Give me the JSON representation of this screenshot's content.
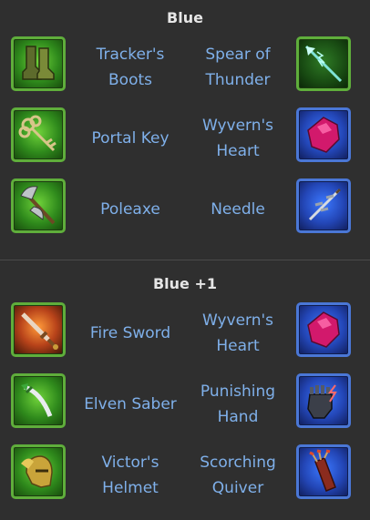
{
  "sections": [
    {
      "title": "Blue",
      "rows": [
        {
          "left": {
            "icon": "boots-icon",
            "color": "green",
            "lines": [
              "Tracker's",
              "Boots"
            ]
          },
          "right": {
            "icon": "spear-icon",
            "color": "green",
            "lines": [
              "Spear of",
              "Thunder"
            ]
          }
        },
        {
          "left": {
            "icon": "key-icon",
            "color": "green",
            "lines": [
              "Portal Key"
            ]
          },
          "right": {
            "icon": "heart-gem-icon",
            "color": "blue",
            "lines": [
              "Wyvern's",
              "Heart"
            ]
          }
        },
        {
          "left": {
            "icon": "poleaxe-icon",
            "color": "green",
            "lines": [
              "Poleaxe"
            ]
          },
          "right": {
            "icon": "needle-icon",
            "color": "blue",
            "lines": [
              "Needle"
            ]
          }
        }
      ]
    },
    {
      "title": "Blue +1",
      "rows": [
        {
          "left": {
            "icon": "fire-sword-icon",
            "color": "green",
            "lines": [
              "Fire Sword"
            ]
          },
          "right": {
            "icon": "heart-gem-icon",
            "color": "blue",
            "lines": [
              "Wyvern's",
              "Heart"
            ]
          }
        },
        {
          "left": {
            "icon": "saber-icon",
            "color": "green",
            "lines": [
              "Elven Saber"
            ]
          },
          "right": {
            "icon": "gauntlet-icon",
            "color": "blue",
            "lines": [
              "Punishing",
              "Hand"
            ]
          }
        },
        {
          "left": {
            "icon": "helmet-icon",
            "color": "green",
            "lines": [
              "Victor's",
              "Helmet"
            ]
          },
          "right": {
            "icon": "quiver-icon",
            "color": "blue",
            "lines": [
              "Scorching",
              "Quiver"
            ]
          }
        }
      ]
    }
  ]
}
